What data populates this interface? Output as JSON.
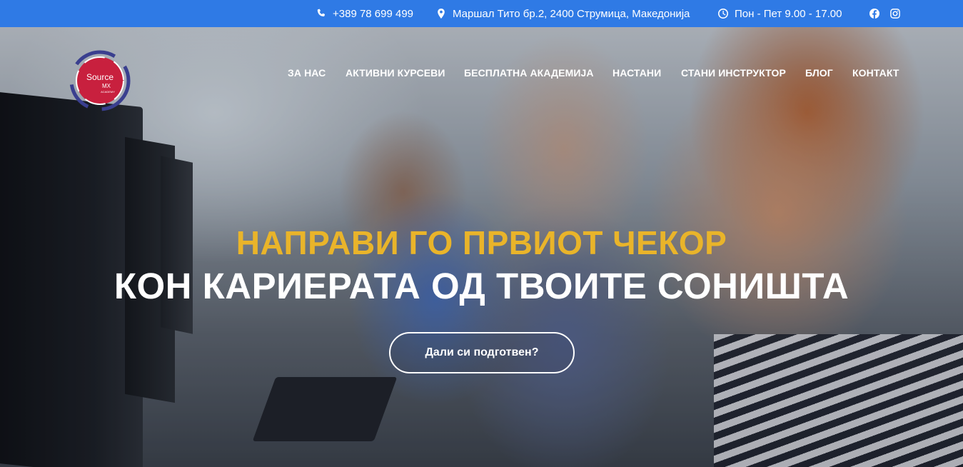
{
  "topbar": {
    "phone": "+389 78 699 499",
    "address": "Маршал Тито бр.2, 2400 Струмица, Македонија",
    "hours": "Пон - Пет 9.00 - 17.00",
    "phone_icon": "phone-icon",
    "address_icon": "map-pin-icon",
    "hours_icon": "clock-icon",
    "social": [
      "facebook-icon",
      "instagram-icon"
    ],
    "background_color": "#2f7ae5"
  },
  "logo": {
    "line1": "Source",
    "line2": "MX",
    "line3": "ACADEMY"
  },
  "nav": {
    "items": [
      "ЗА НАС",
      "АКТИВНИ КУРСЕВИ",
      "БЕСПЛАТНА АКАДЕМИЈА",
      "НАСТАНИ",
      "СТАНИ ИНСТРУКТОР",
      "БЛОГ",
      "КОНТАКТ"
    ]
  },
  "hero": {
    "headline_1": "НАПРАВИ ГО ПРВИОТ ЧЕКОР",
    "headline_2": "КОН КАРИЕРАТА ОД ТВОИТЕ СОНИШТА",
    "cta_label": "Дали си подготвен?",
    "accent_color": "#e9b42a"
  }
}
